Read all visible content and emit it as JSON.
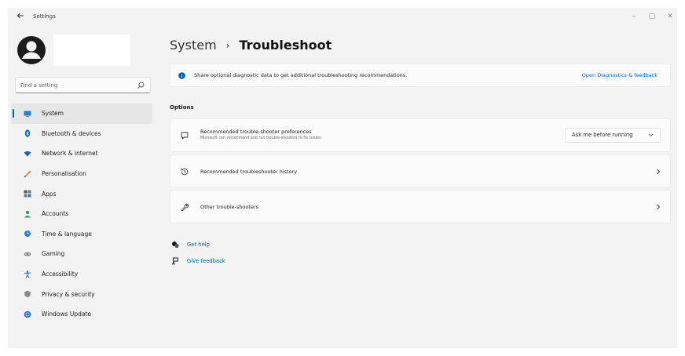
{
  "window": {
    "title": "Settings",
    "controls": {
      "minimize": "–",
      "maximize": "▢",
      "close": "✕"
    }
  },
  "colors": {
    "accent": "#005fb8",
    "background": "#f3f3f3",
    "card": "#fbfbfb"
  },
  "search": {
    "placeholder": "Find a setting"
  },
  "sidebar": {
    "items": [
      {
        "label": "System",
        "icon": "monitor-icon",
        "active": true
      },
      {
        "label": "Bluetooth & devices",
        "icon": "bluetooth-icon"
      },
      {
        "label": "Network & internet",
        "icon": "wifi-icon"
      },
      {
        "label": "Personalisation",
        "icon": "brush-icon"
      },
      {
        "label": "Apps",
        "icon": "apps-icon"
      },
      {
        "label": "Accounts",
        "icon": "accounts-icon"
      },
      {
        "label": "Time & language",
        "icon": "globe-clock-icon"
      },
      {
        "label": "Gaming",
        "icon": "gamepad-icon"
      },
      {
        "label": "Accessibility",
        "icon": "accessibility-icon"
      },
      {
        "label": "Privacy & security",
        "icon": "shield-icon"
      },
      {
        "label": "Windows Update",
        "icon": "windows-update-icon"
      }
    ]
  },
  "breadcrumb": {
    "parent": "System",
    "separator": "›",
    "current": "Troubleshoot"
  },
  "info_banner": {
    "text": "Share optional diagnostic data to get additional troubleshooting recommendations.",
    "link": "Open Diagnostics & feedback"
  },
  "options": {
    "heading": "Options",
    "preferences": {
      "title": "Recommended trouble-shooter preferences",
      "subtitle": "Microsoft can recommend and run trouble-shooters to fix issues",
      "dropdown_value": "Ask me before running"
    },
    "history": {
      "title": "Recommended troubleshooter history"
    },
    "other": {
      "title": "Other trouble-shooters"
    }
  },
  "help": {
    "get_help": "Get help",
    "give_feedback": "Give feedback"
  }
}
